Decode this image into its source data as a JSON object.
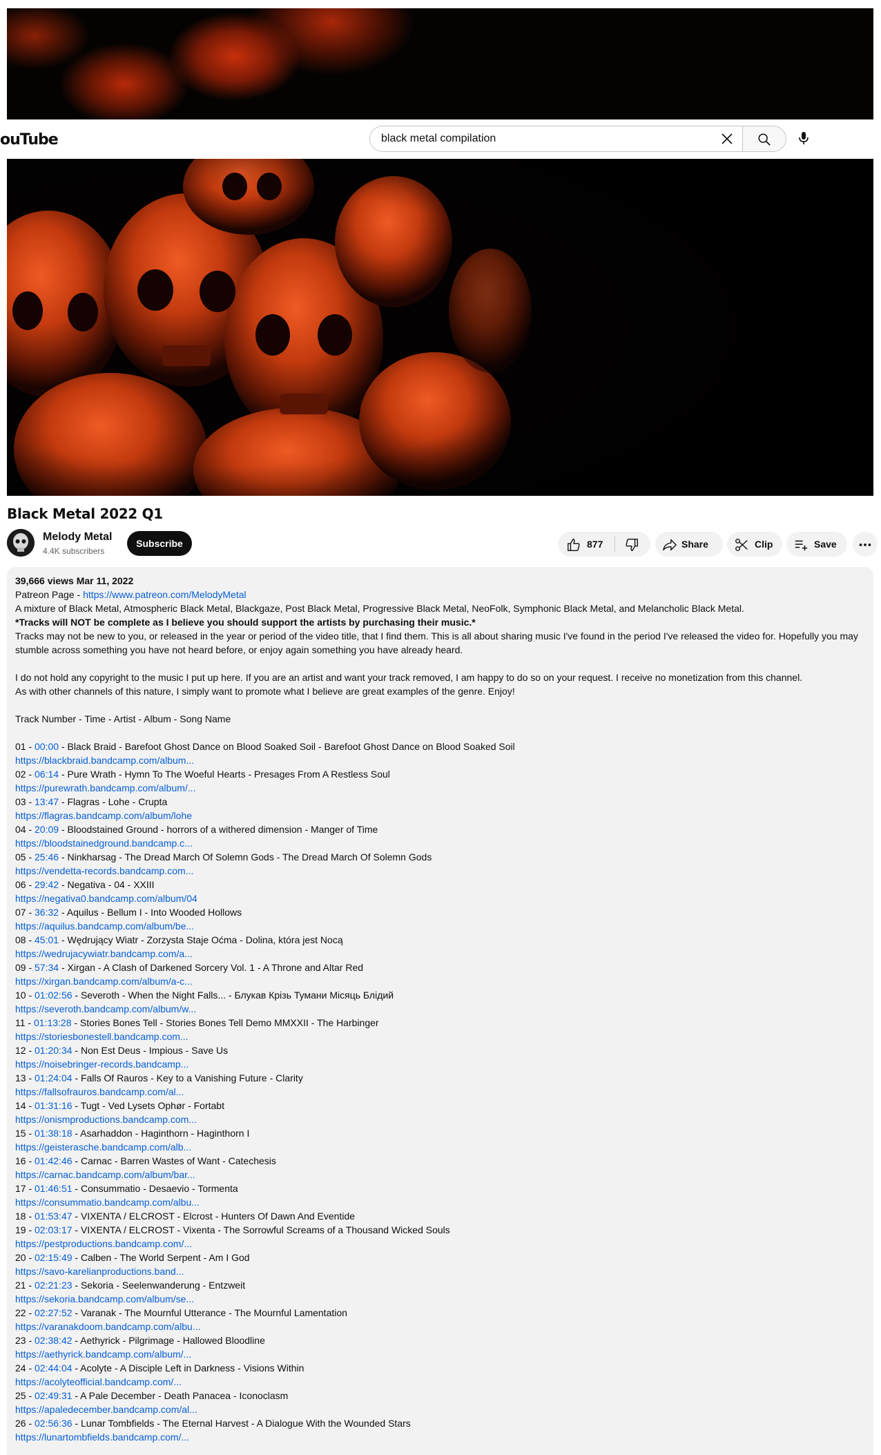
{
  "masthead": {
    "logo_text": "ouTube",
    "search_value": "black metal compilation"
  },
  "video": {
    "title": "Black Metal 2022 Q1",
    "channel_name": "Melody Metal",
    "subscribers": "4.4K subscribers",
    "subscribe_label": "Subscribe",
    "likes": "877",
    "share_label": "Share",
    "clip_label": "Clip",
    "save_label": "Save"
  },
  "description": {
    "views_date": "39,666 views  Mar 11, 2022",
    "patreon_prefix": "Patreon Page - ",
    "patreon_link": "https://www.patreon.com/MelodyMetal",
    "mixture": "A mixture of Black Metal, Atmospheric Black Metal, Blackgaze, Post Black Metal,  Progressive Black Metal, NeoFolk, Symphonic Black Metal, and Melancholic Black Metal.",
    "tracks_note": "*Tracks will NOT be complete as I believe you should support the artists by purchasing their music.*",
    "not_new": "Tracks may not be new to you, or released in the year or period of the video title, that I find them.  This is all about sharing music I've found in the period I've released the video for. Hopefully you may stumble across something you have not heard before, or enjoy again something you have already heard.",
    "copyright": "I do not hold any copyright to the music I put up here. If you are an artist and want your track removed, I am happy to do so on your request. I receive no monetization from this channel.",
    "promote": "As with other channels of this nature, I simply want to promote what I believe are great examples of the genre. Enjoy!",
    "track_header": "Track Number - Time - Artist - Album - Song Name",
    "tracks": [
      {
        "num": "01 - ",
        "time": "00:00",
        "text": " - Black Braid - Barefoot Ghost Dance on Blood Soaked Soil - Barefoot Ghost Dance on Blood Soaked Soil",
        "link": "https://blackbraid.bandcamp.com/album..."
      },
      {
        "num": "02 - ",
        "time": "06:14",
        "text": " - Pure Wrath - Hymn To The Woeful Hearts - Presages From A Restless Soul",
        "link": "https://purewrath.bandcamp.com/album/..."
      },
      {
        "num": "03 - ",
        "time": "13:47",
        "text": " - Flagras - Lohe - Crupta",
        "link": "https://flagras.bandcamp.com/album/lohe"
      },
      {
        "num": "04 - ",
        "time": "20:09",
        "text": " - Bloodstained Ground - horrors of a withered dimension - Manger of Time",
        "link": "https://bloodstainedground.bandcamp.c..."
      },
      {
        "num": "05 - ",
        "time": "25:46",
        "text": " - Ninkharsag - The Dread March Of Solemn Gods - The Dread March Of Solemn Gods",
        "link": "https://vendetta-records.bandcamp.com..."
      },
      {
        "num": "06 - ",
        "time": "29:42",
        "text": " - Negativa - 04 - XXIII",
        "link": "https://negativa0.bandcamp.com/album/04"
      },
      {
        "num": "07 - ",
        "time": "36:32",
        "text": " - Aquilus - Bellum I - Into Wooded Hollows",
        "link": "https://aquilus.bandcamp.com/album/be..."
      },
      {
        "num": "08 - ",
        "time": "45:01",
        "text": " - Wędrujący Wiatr - Zorzysta Staje Oćma - Dolina, która jest Nocą",
        "link": "https://wedrujacywiatr.bandcamp.com/a..."
      },
      {
        "num": "09 - ",
        "time": "57:34",
        "text": " - Xirgan - A Clash of Darkened Sorcery Vol. 1 - A Throne and Altar Red",
        "link": "https://xirgan.bandcamp.com/album/a-c..."
      },
      {
        "num": "10 - ",
        "time": "01:02:56",
        "text": " - Severoth - When the Night Falls... - Блукав Крізь Тумани Місяць Блідий",
        "link": "https://severoth.bandcamp.com/album/w..."
      },
      {
        "num": "11 - ",
        "time": "01:13:28",
        "text": " - Stories Bones Tell - Stories Bones Tell Demo MMXXII - The Harbinger",
        "link": "https://storiesbonestell.bandcamp.com..."
      },
      {
        "num": "12 - ",
        "time": "01:20:34",
        "text": " - Non Est Deus - Impious - Save Us",
        "link": "https://noisebringer-records.bandcamp..."
      },
      {
        "num": "13 - ",
        "time": "01:24:04",
        "text": " - Falls Of Rauros - Key to a Vanishing Future - Clarity",
        "link": "https://fallsofrauros.bandcamp.com/al..."
      },
      {
        "num": "14 - ",
        "time": "01:31:16",
        "text": " - Tugt - Ved Lysets Ophør - Fortabt",
        "link": "https://onismproductions.bandcamp.com..."
      },
      {
        "num": "15 - ",
        "time": "01:38:18",
        "text": " - Asarhaddon - Haginthorn - Haginthorn I",
        "link": "https://geisterasche.bandcamp.com/alb..."
      },
      {
        "num": "16 - ",
        "time": "01:42:46",
        "text": " - Carnac - Barren Wastes of Want - Catechesis",
        "link": "https://carnac.bandcamp.com/album/bar..."
      },
      {
        "num": "17 - ",
        "time": "01:46:51",
        "text": " - Consummatio - Desaevio - Tormenta",
        "link": "https://consummatio.bandcamp.com/albu..."
      },
      {
        "num": "18 - ",
        "time": "01:53:47",
        "text": " - VIXENTA / ELCROST - Elcrost - Hunters Of Dawn And Eventide",
        "link": ""
      },
      {
        "num": "19 - ",
        "time": "02:03:17",
        "text": " - VIXENTA / ELCROST - Vixenta - The Sorrowful Screams of a Thousand Wicked Souls",
        "link": "https://pestproductions.bandcamp.com/..."
      },
      {
        "num": "20 - ",
        "time": "02:15:49",
        "text": " - Calben - The World Serpent - Am I God",
        "link": "https://savo-karelianproductions.band..."
      },
      {
        "num": "21 - ",
        "time": "02:21:23",
        "text": " - Sekoria - Seelenwanderung - Entzweit",
        "link": "https://sekoria.bandcamp.com/album/se..."
      },
      {
        "num": "22 - ",
        "time": "02:27:52",
        "text": " - Varanak - The Mournful Utterance - The Mournful Lamentation",
        "link": "https://varanakdoom.bandcamp.com/albu..."
      },
      {
        "num": "23 - ",
        "time": "02:38:42",
        "text": " - Aethyrick - Pilgrimage - Hallowed Bloodline",
        "link": "https://aethyrick.bandcamp.com/album/..."
      },
      {
        "num": "24 - ",
        "time": "02:44:04",
        "text": " - Acolyte - A Disciple Left in Darkness - Visions Within",
        "link": "https://acolyteofficial.bandcamp.com/..."
      },
      {
        "num": "25 - ",
        "time": "02:49:31",
        "text": " - A Pale December - Death Panacea - Iconoclasm",
        "link": "https://apaledecember.bandcamp.com/al..."
      },
      {
        "num": "26 - ",
        "time": "02:56:36",
        "text": " - Lunar Tombfields - The Eternal Harvest - A Dialogue With the Wounded Stars",
        "link": "https://lunartombfields.bandcamp.com/..."
      }
    ]
  },
  "colors": {
    "link": "#065fd4",
    "subscribe_bg": "#0f0f0f",
    "desc_bg": "#f2f2f2"
  },
  "icons": [
    "clear-icon",
    "search-icon",
    "mic-icon",
    "like-icon",
    "dislike-icon",
    "share-icon",
    "clip-icon",
    "save-icon",
    "more-icon"
  ]
}
